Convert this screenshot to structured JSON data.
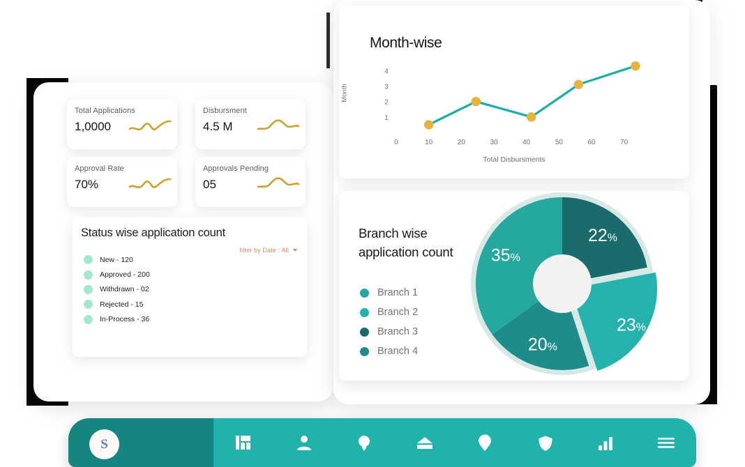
{
  "kpi_cards": [
    {
      "label": "Total Applications",
      "value": "1,0000",
      "icon": "sparkline-icon"
    },
    {
      "label": "Disbursment",
      "value": "4.5 M",
      "icon": "sparkline-icon"
    },
    {
      "label": "Approval Rate",
      "value": "70%",
      "icon": "sparkline-icon"
    },
    {
      "label": "Approvals Pending",
      "value": "05",
      "icon": "sparkline-icon"
    }
  ],
  "status_panel": {
    "title": "Status wise application count",
    "filter_label": "filter by Date : All",
    "filter_icon": "chevron-down-icon",
    "dot_color": "#a6e5cf",
    "items": [
      {
        "label": "New - 120"
      },
      {
        "label": "Approved - 200"
      },
      {
        "label": "Withdrawn - 02"
      },
      {
        "label": "Rejected - 15"
      },
      {
        "label": "In-Process - 36"
      }
    ]
  },
  "navbar": {
    "brand_initial": "S",
    "brand_color": "#6b77c9",
    "bar_color": "#1fb3ab",
    "brand_panel_color": "#17857f",
    "items": [
      {
        "icon": "dashboard-grid-icon"
      },
      {
        "icon": "user-icon"
      },
      {
        "icon": "lightbulb-icon"
      },
      {
        "icon": "home-icon"
      },
      {
        "icon": "location-pin-icon"
      },
      {
        "icon": "shield-icon"
      },
      {
        "icon": "bar-chart-icon"
      },
      {
        "icon": "hamburger-menu-icon"
      }
    ]
  },
  "chart_data": [
    {
      "type": "line",
      "title": "Month-wise",
      "xlabel": "Total Disbursments",
      "ylabel": "Month",
      "x": [
        10,
        24.5,
        41.5,
        56,
        73.5
      ],
      "values": [
        0.5,
        2,
        1,
        3.1,
        4.3
      ],
      "xlim": [
        0,
        78
      ],
      "ylim": [
        0,
        4.6
      ],
      "xticks": [
        0,
        10,
        20,
        30,
        40,
        50,
        60,
        70
      ],
      "yticks": [
        1,
        2,
        3,
        4
      ],
      "grid": false,
      "line_color": "#1aada6",
      "marker_color": "#e8b43f",
      "legend": "none"
    },
    {
      "type": "pie",
      "title": "Branch wise application count",
      "categories": [
        "Branch 1",
        "Branch 2",
        "Branch 3",
        "Branch 4"
      ],
      "values": [
        35,
        23,
        22,
        20
      ],
      "labels": [
        "35%",
        "23%",
        "22%",
        "20%"
      ],
      "colors": [
        "#25a89e",
        "#26b2ac",
        "#1a6b6b",
        "#1e8c8a"
      ],
      "donut": true,
      "exploded_slice": "Branch 2",
      "ring_color": "#d8e8e6",
      "legend": "left"
    }
  ]
}
